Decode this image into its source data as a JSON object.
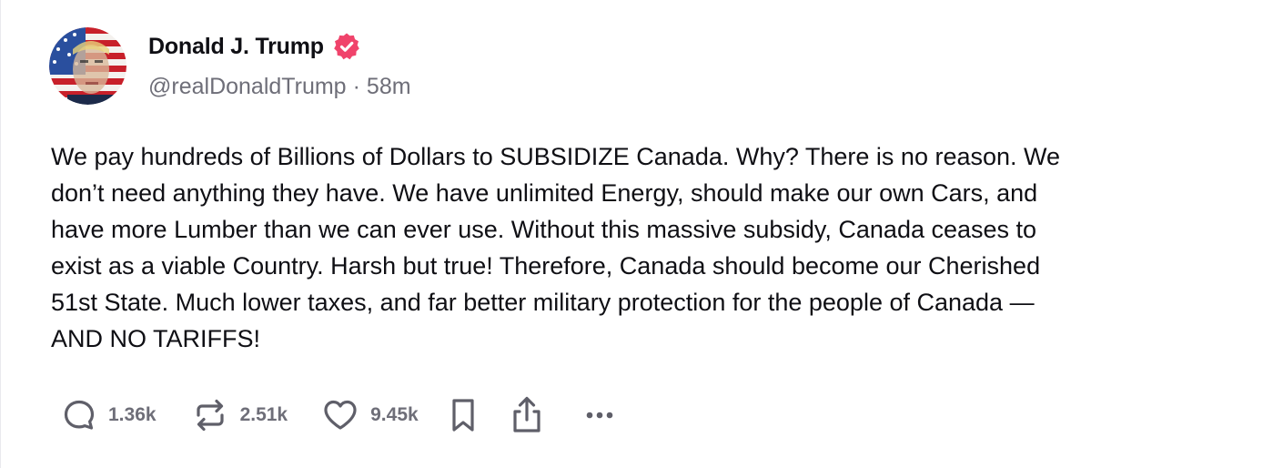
{
  "author": {
    "display_name": "Donald J. Trump",
    "handle": "@realDonaldTrump",
    "separator": "·",
    "time_ago": "58m",
    "verified": true,
    "verified_color": "#f0436b"
  },
  "post": {
    "text": "We pay hundreds of Billions of Dollars to SUBSIDIZE Canada. Why? There is no reason. We\ndon’t need anything they have. We have unlimited Energy, should make our own Cars, and\nhave more Lumber than we can ever use. Without this massive subsidy, Canada ceases to\nexist as a viable Country. Harsh but true! Therefore, Canada should become our Cherished\n51st State. Much lower taxes, and far better military protection for the people of Canada —\nAND NO TARIFFS!"
  },
  "actions": {
    "replies": {
      "icon": "reply-icon",
      "count": "1.36k"
    },
    "reposts": {
      "icon": "repost-icon",
      "count": "2.51k"
    },
    "likes": {
      "icon": "heart-icon",
      "count": "9.45k"
    },
    "bookmark": {
      "icon": "bookmark-icon"
    },
    "share": {
      "icon": "share-icon"
    },
    "more": {
      "icon": "more-icon"
    }
  },
  "colors": {
    "text": "#0f0f14",
    "muted": "#6e6e78",
    "icon": "#5f5f69"
  }
}
